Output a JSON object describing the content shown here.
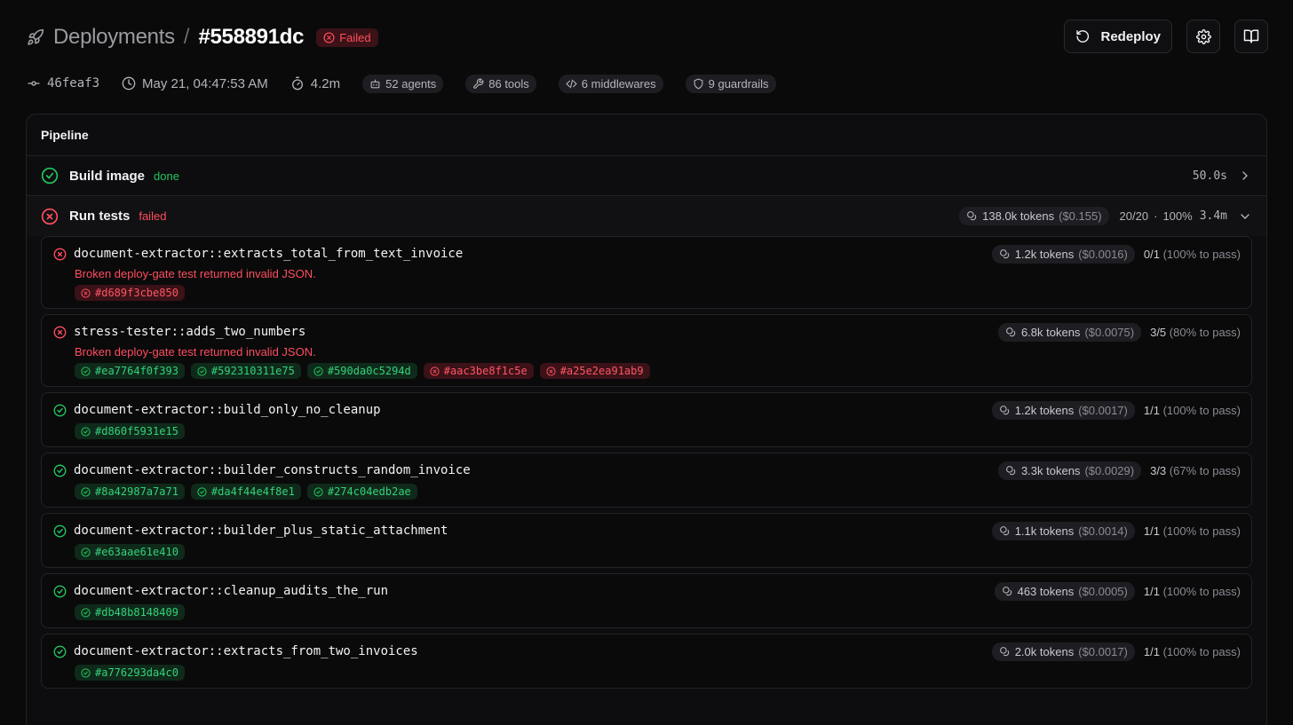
{
  "header": {
    "breadcrumb_root": "Deployments",
    "separator": "/",
    "deployment_id": "#558891dc",
    "status": "Failed",
    "redeploy_label": "Redeploy"
  },
  "meta": {
    "commit": "46feaf3",
    "timestamp": "May 21, 04:47:53 AM",
    "duration": "4.2m",
    "agents": "52 agents",
    "tools": "86 tools",
    "middlewares": "6 middlewares",
    "guardrails": "9 guardrails"
  },
  "pipeline": {
    "title": "Pipeline",
    "stages": [
      {
        "name": "Build image",
        "status": "done",
        "time": "50.0s"
      },
      {
        "name": "Run tests",
        "status": "failed",
        "tokens": "138.0k tokens",
        "cost": "($0.155)",
        "progress": "20/20",
        "dot": "·",
        "percent": "100%",
        "time": "3.4m"
      }
    ]
  },
  "tests": [
    {
      "name": "document-extractor::extracts_total_from_text_invoice",
      "state": "fail",
      "tokens": "1.2k tokens",
      "cost": "($0.0016)",
      "count": "0/1",
      "pct": "(100% to pass)",
      "error": "Broken deploy-gate test returned invalid JSON.",
      "runs": [
        {
          "id": "#d689f3cbe850",
          "ok": false
        }
      ]
    },
    {
      "name": "stress-tester::adds_two_numbers",
      "state": "fail",
      "tokens": "6.8k tokens",
      "cost": "($0.0075)",
      "count": "3/5",
      "pct": "(80% to pass)",
      "error": "Broken deploy-gate test returned invalid JSON.",
      "runs": [
        {
          "id": "#ea7764f0f393",
          "ok": true
        },
        {
          "id": "#592310311e75",
          "ok": true
        },
        {
          "id": "#590da0c5294d",
          "ok": true
        },
        {
          "id": "#aac3be8f1c5e",
          "ok": false
        },
        {
          "id": "#a25e2ea91ab9",
          "ok": false
        }
      ]
    },
    {
      "name": "document-extractor::build_only_no_cleanup",
      "state": "pass",
      "tokens": "1.2k tokens",
      "cost": "($0.0017)",
      "count": "1/1",
      "pct": "(100% to pass)",
      "error": "",
      "runs": [
        {
          "id": "#d860f5931e15",
          "ok": true
        }
      ]
    },
    {
      "name": "document-extractor::builder_constructs_random_invoice",
      "state": "pass",
      "tokens": "3.3k tokens",
      "cost": "($0.0029)",
      "count": "3/3",
      "pct": "(67% to pass)",
      "error": "",
      "runs": [
        {
          "id": "#8a42987a7a71",
          "ok": true
        },
        {
          "id": "#da4f44e4f8e1",
          "ok": true
        },
        {
          "id": "#274c04edb2ae",
          "ok": true
        }
      ]
    },
    {
      "name": "document-extractor::builder_plus_static_attachment",
      "state": "pass",
      "tokens": "1.1k tokens",
      "cost": "($0.0014)",
      "count": "1/1",
      "pct": "(100% to pass)",
      "error": "",
      "runs": [
        {
          "id": "#e63aae61e410",
          "ok": true
        }
      ]
    },
    {
      "name": "document-extractor::cleanup_audits_the_run",
      "state": "pass",
      "tokens": "463 tokens",
      "cost": "($0.0005)",
      "count": "1/1",
      "pct": "(100% to pass)",
      "error": "",
      "runs": [
        {
          "id": "#db48b8148409",
          "ok": true
        }
      ]
    },
    {
      "name": "document-extractor::extracts_from_two_invoices",
      "state": "pass",
      "tokens": "2.0k tokens",
      "cost": "($0.0017)",
      "count": "1/1",
      "pct": "(100% to pass)",
      "error": "",
      "runs": [
        {
          "id": "#a776293da4c0",
          "ok": true
        }
      ]
    }
  ],
  "colors": {
    "success": "#22c55e",
    "failure": "#ff4d5e",
    "background": "#0a0a0b"
  }
}
